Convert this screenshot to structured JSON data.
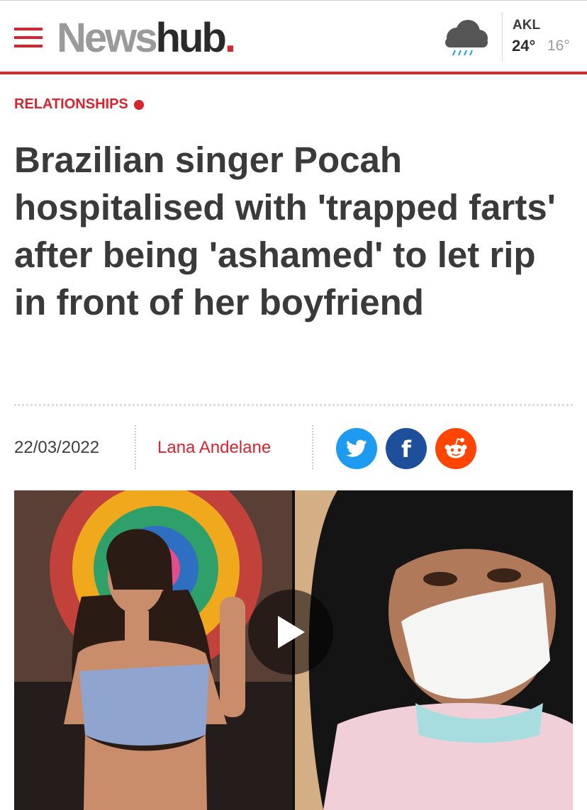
{
  "header": {
    "menu_icon": "hamburger-menu-icon",
    "logo": {
      "news": "News",
      "hub": "hub",
      "dot": "."
    },
    "weather": {
      "icon": "rain-cloud-icon",
      "city": "AKL",
      "high": "24°",
      "low": "16°"
    }
  },
  "article": {
    "category": "RELATIONSHIPS",
    "title": "Brazilian singer Pocah hospitalised with 'trapped farts' after being 'ashamed' to let rip in front of her boyfriend",
    "date": "22/03/2022",
    "author": "Lana Andelane"
  },
  "share": {
    "twitter_icon": "twitter-bird-icon",
    "facebook_icon": "facebook-icon",
    "facebook_letter": "f",
    "reddit_icon": "reddit-icon"
  },
  "media": {
    "play_icon": "play-icon"
  },
  "colors": {
    "brand_red": "#d8242e",
    "twitter": "#1d9bf0",
    "facebook": "#1e4f9a",
    "reddit": "#ff4500"
  }
}
